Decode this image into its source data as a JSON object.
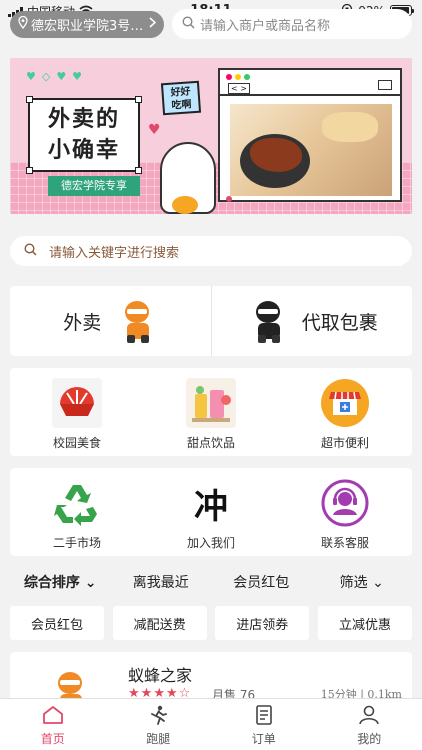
{
  "status_bar": {
    "carrier": "中国移动",
    "time": "18:11",
    "battery": "92%",
    "battery_level": 0.92
  },
  "header": {
    "location": "德宏职业学院3号…",
    "search_placeholder": "请输入商户或商品名称"
  },
  "banner": {
    "title_line1": "外卖的",
    "title_line2": "小确幸",
    "tag": "德宏学院专享",
    "bubble_line1": "好好",
    "bubble_line2": "吃啊"
  },
  "search2": {
    "placeholder": "请输入关键字进行搜索"
  },
  "big_cards": [
    {
      "label": "外卖",
      "icon": "ninja-orange-icon"
    },
    {
      "label": "代取包裹",
      "icon": "ninja-black-icon"
    }
  ],
  "categories_row1": [
    {
      "label": "校园美食",
      "icon": "bowl-icon"
    },
    {
      "label": "甜点饮品",
      "icon": "drinks-icon"
    },
    {
      "label": "超市便利",
      "icon": "store-icon"
    }
  ],
  "categories_row2": [
    {
      "label": "二手市场",
      "icon": "recycle-icon"
    },
    {
      "label": "加入我们",
      "icon": "brush-character-icon",
      "glyph": "冲"
    },
    {
      "label": "联系客服",
      "icon": "customer-service-icon"
    }
  ],
  "filters": {
    "sort": "综合排序",
    "nearest": "离我最近",
    "member": "会员红包",
    "filter": "筛选"
  },
  "chips": [
    "会员红包",
    "减配送费",
    "进店领券",
    "立减优惠"
  ],
  "shop": {
    "name": "蚁蜂之家",
    "rating": 4,
    "sales": "月售 76",
    "time_distance": "15分钟 | 0.1km"
  },
  "tabs": [
    {
      "label": "首页",
      "icon": "home-icon",
      "active": true
    },
    {
      "label": "跑腿",
      "icon": "runner-icon",
      "active": false
    },
    {
      "label": "订单",
      "icon": "order-icon",
      "active": false
    },
    {
      "label": "我的",
      "icon": "profile-icon",
      "active": false
    }
  ],
  "colors": {
    "accent": "#e0496a",
    "brand_green": "#2fa37b",
    "banner_pink": "#f7cedb"
  }
}
